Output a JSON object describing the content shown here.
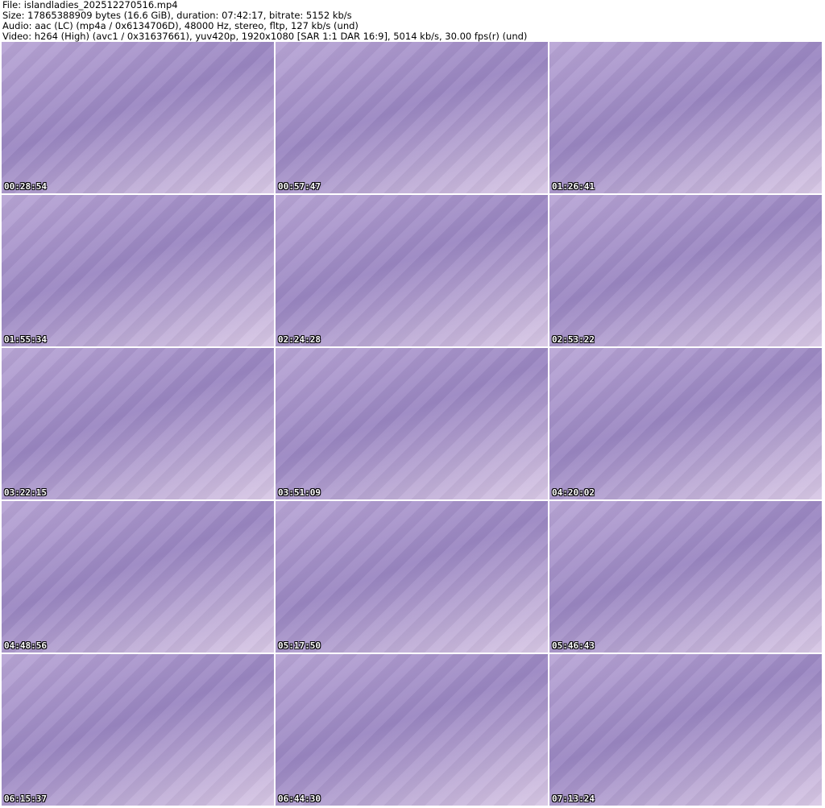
{
  "header": {
    "file": "File: islandladies_202512270516.mp4",
    "size": "Size: 17865388909 bytes (16.6 GiB), duration: 07:42:17, bitrate: 5152 kb/s",
    "audio": "Audio: aac (LC) (mp4a / 0x6134706D), 48000 Hz, stereo, fltp, 127 kb/s (und)",
    "video": "Video: h264 (High) (avc1 / 0x31637661), yuv420p, 1920x1080 [SAR 1:1 DAR 16:9], 5014 kb/s, 30.00 fps(r) (und)"
  },
  "thumbnails": [
    {
      "time": "00:28:54"
    },
    {
      "time": "00:57:47"
    },
    {
      "time": "01:26:41"
    },
    {
      "time": "01:55:34"
    },
    {
      "time": "02:24:28"
    },
    {
      "time": "02:53:22"
    },
    {
      "time": "03:22:15"
    },
    {
      "time": "03:51:09"
    },
    {
      "time": "04:20:02"
    },
    {
      "time": "04:48:56"
    },
    {
      "time": "05:17:50"
    },
    {
      "time": "05:46:43"
    },
    {
      "time": "06:15:37"
    },
    {
      "time": "06:44:30"
    },
    {
      "time": "07:13:24"
    }
  ]
}
